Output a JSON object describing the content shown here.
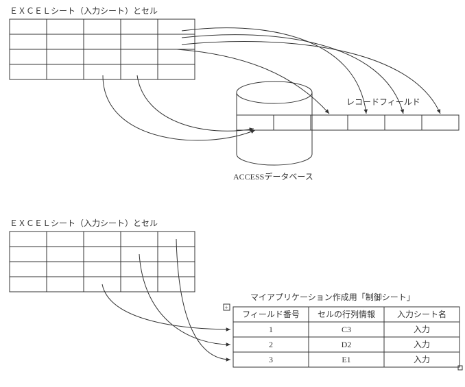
{
  "diagram1": {
    "title": "ＥＸＣＥＬシート（入力シート）とセル",
    "db_label": "ACCESSデータベース",
    "record_label": "レコードフィールド"
  },
  "diagram2": {
    "title": "ＥＸＣＥＬシート（入力シート）とセル",
    "control_title": "マイアプリケーション作成用「制御シート」",
    "headers": {
      "col1": "フィールド番号",
      "col2": "セルの行列情報",
      "col3": "入力シート名"
    },
    "rows": [
      {
        "no": "1",
        "rc": "C3",
        "sheet": "入力"
      },
      {
        "no": "2",
        "rc": "D2",
        "sheet": "入力"
      },
      {
        "no": "3",
        "rc": "E1",
        "sheet": "入力"
      }
    ],
    "expand_icon": "+"
  }
}
